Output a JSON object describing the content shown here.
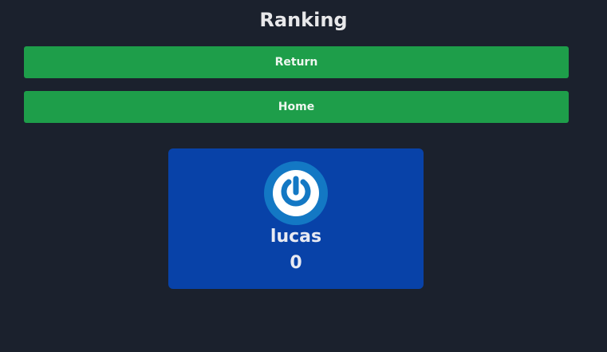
{
  "header": {
    "title": "Ranking"
  },
  "buttons": {
    "return_label": "Return",
    "home_label": "Home"
  },
  "ranking": [
    {
      "name": "lucas",
      "score": "0",
      "avatar_icon": "power-icon"
    }
  ],
  "colors": {
    "background": "#1b212d",
    "button": "#1e9e4a",
    "card": "#0842a8",
    "avatar_ring": "#1378c4"
  }
}
